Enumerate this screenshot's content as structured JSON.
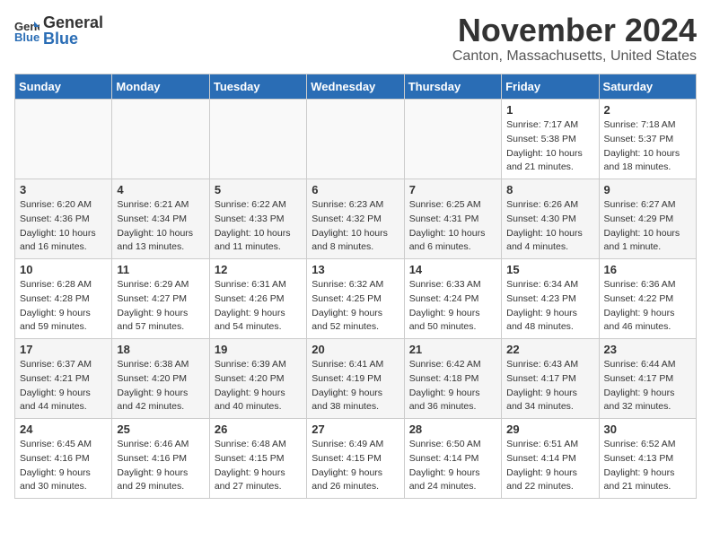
{
  "header": {
    "logo_general": "General",
    "logo_blue": "Blue",
    "month_title": "November 2024",
    "location": "Canton, Massachusetts, United States"
  },
  "days_of_week": [
    "Sunday",
    "Monday",
    "Tuesday",
    "Wednesday",
    "Thursday",
    "Friday",
    "Saturday"
  ],
  "weeks": [
    [
      {
        "day": "",
        "sunrise": "",
        "sunset": "",
        "daylight": ""
      },
      {
        "day": "",
        "sunrise": "",
        "sunset": "",
        "daylight": ""
      },
      {
        "day": "",
        "sunrise": "",
        "sunset": "",
        "daylight": ""
      },
      {
        "day": "",
        "sunrise": "",
        "sunset": "",
        "daylight": ""
      },
      {
        "day": "",
        "sunrise": "",
        "sunset": "",
        "daylight": ""
      },
      {
        "day": "1",
        "sunrise": "Sunrise: 7:17 AM",
        "sunset": "Sunset: 5:38 PM",
        "daylight": "Daylight: 10 hours and 21 minutes."
      },
      {
        "day": "2",
        "sunrise": "Sunrise: 7:18 AM",
        "sunset": "Sunset: 5:37 PM",
        "daylight": "Daylight: 10 hours and 18 minutes."
      }
    ],
    [
      {
        "day": "3",
        "sunrise": "Sunrise: 6:20 AM",
        "sunset": "Sunset: 4:36 PM",
        "daylight": "Daylight: 10 hours and 16 minutes."
      },
      {
        "day": "4",
        "sunrise": "Sunrise: 6:21 AM",
        "sunset": "Sunset: 4:34 PM",
        "daylight": "Daylight: 10 hours and 13 minutes."
      },
      {
        "day": "5",
        "sunrise": "Sunrise: 6:22 AM",
        "sunset": "Sunset: 4:33 PM",
        "daylight": "Daylight: 10 hours and 11 minutes."
      },
      {
        "day": "6",
        "sunrise": "Sunrise: 6:23 AM",
        "sunset": "Sunset: 4:32 PM",
        "daylight": "Daylight: 10 hours and 8 minutes."
      },
      {
        "day": "7",
        "sunrise": "Sunrise: 6:25 AM",
        "sunset": "Sunset: 4:31 PM",
        "daylight": "Daylight: 10 hours and 6 minutes."
      },
      {
        "day": "8",
        "sunrise": "Sunrise: 6:26 AM",
        "sunset": "Sunset: 4:30 PM",
        "daylight": "Daylight: 10 hours and 4 minutes."
      },
      {
        "day": "9",
        "sunrise": "Sunrise: 6:27 AM",
        "sunset": "Sunset: 4:29 PM",
        "daylight": "Daylight: 10 hours and 1 minute."
      }
    ],
    [
      {
        "day": "10",
        "sunrise": "Sunrise: 6:28 AM",
        "sunset": "Sunset: 4:28 PM",
        "daylight": "Daylight: 9 hours and 59 minutes."
      },
      {
        "day": "11",
        "sunrise": "Sunrise: 6:29 AM",
        "sunset": "Sunset: 4:27 PM",
        "daylight": "Daylight: 9 hours and 57 minutes."
      },
      {
        "day": "12",
        "sunrise": "Sunrise: 6:31 AM",
        "sunset": "Sunset: 4:26 PM",
        "daylight": "Daylight: 9 hours and 54 minutes."
      },
      {
        "day": "13",
        "sunrise": "Sunrise: 6:32 AM",
        "sunset": "Sunset: 4:25 PM",
        "daylight": "Daylight: 9 hours and 52 minutes."
      },
      {
        "day": "14",
        "sunrise": "Sunrise: 6:33 AM",
        "sunset": "Sunset: 4:24 PM",
        "daylight": "Daylight: 9 hours and 50 minutes."
      },
      {
        "day": "15",
        "sunrise": "Sunrise: 6:34 AM",
        "sunset": "Sunset: 4:23 PM",
        "daylight": "Daylight: 9 hours and 48 minutes."
      },
      {
        "day": "16",
        "sunrise": "Sunrise: 6:36 AM",
        "sunset": "Sunset: 4:22 PM",
        "daylight": "Daylight: 9 hours and 46 minutes."
      }
    ],
    [
      {
        "day": "17",
        "sunrise": "Sunrise: 6:37 AM",
        "sunset": "Sunset: 4:21 PM",
        "daylight": "Daylight: 9 hours and 44 minutes."
      },
      {
        "day": "18",
        "sunrise": "Sunrise: 6:38 AM",
        "sunset": "Sunset: 4:20 PM",
        "daylight": "Daylight: 9 hours and 42 minutes."
      },
      {
        "day": "19",
        "sunrise": "Sunrise: 6:39 AM",
        "sunset": "Sunset: 4:20 PM",
        "daylight": "Daylight: 9 hours and 40 minutes."
      },
      {
        "day": "20",
        "sunrise": "Sunrise: 6:41 AM",
        "sunset": "Sunset: 4:19 PM",
        "daylight": "Daylight: 9 hours and 38 minutes."
      },
      {
        "day": "21",
        "sunrise": "Sunrise: 6:42 AM",
        "sunset": "Sunset: 4:18 PM",
        "daylight": "Daylight: 9 hours and 36 minutes."
      },
      {
        "day": "22",
        "sunrise": "Sunrise: 6:43 AM",
        "sunset": "Sunset: 4:17 PM",
        "daylight": "Daylight: 9 hours and 34 minutes."
      },
      {
        "day": "23",
        "sunrise": "Sunrise: 6:44 AM",
        "sunset": "Sunset: 4:17 PM",
        "daylight": "Daylight: 9 hours and 32 minutes."
      }
    ],
    [
      {
        "day": "24",
        "sunrise": "Sunrise: 6:45 AM",
        "sunset": "Sunset: 4:16 PM",
        "daylight": "Daylight: 9 hours and 30 minutes."
      },
      {
        "day": "25",
        "sunrise": "Sunrise: 6:46 AM",
        "sunset": "Sunset: 4:16 PM",
        "daylight": "Daylight: 9 hours and 29 minutes."
      },
      {
        "day": "26",
        "sunrise": "Sunrise: 6:48 AM",
        "sunset": "Sunset: 4:15 PM",
        "daylight": "Daylight: 9 hours and 27 minutes."
      },
      {
        "day": "27",
        "sunrise": "Sunrise: 6:49 AM",
        "sunset": "Sunset: 4:15 PM",
        "daylight": "Daylight: 9 hours and 26 minutes."
      },
      {
        "day": "28",
        "sunrise": "Sunrise: 6:50 AM",
        "sunset": "Sunset: 4:14 PM",
        "daylight": "Daylight: 9 hours and 24 minutes."
      },
      {
        "day": "29",
        "sunrise": "Sunrise: 6:51 AM",
        "sunset": "Sunset: 4:14 PM",
        "daylight": "Daylight: 9 hours and 22 minutes."
      },
      {
        "day": "30",
        "sunrise": "Sunrise: 6:52 AM",
        "sunset": "Sunset: 4:13 PM",
        "daylight": "Daylight: 9 hours and 21 minutes."
      }
    ]
  ]
}
